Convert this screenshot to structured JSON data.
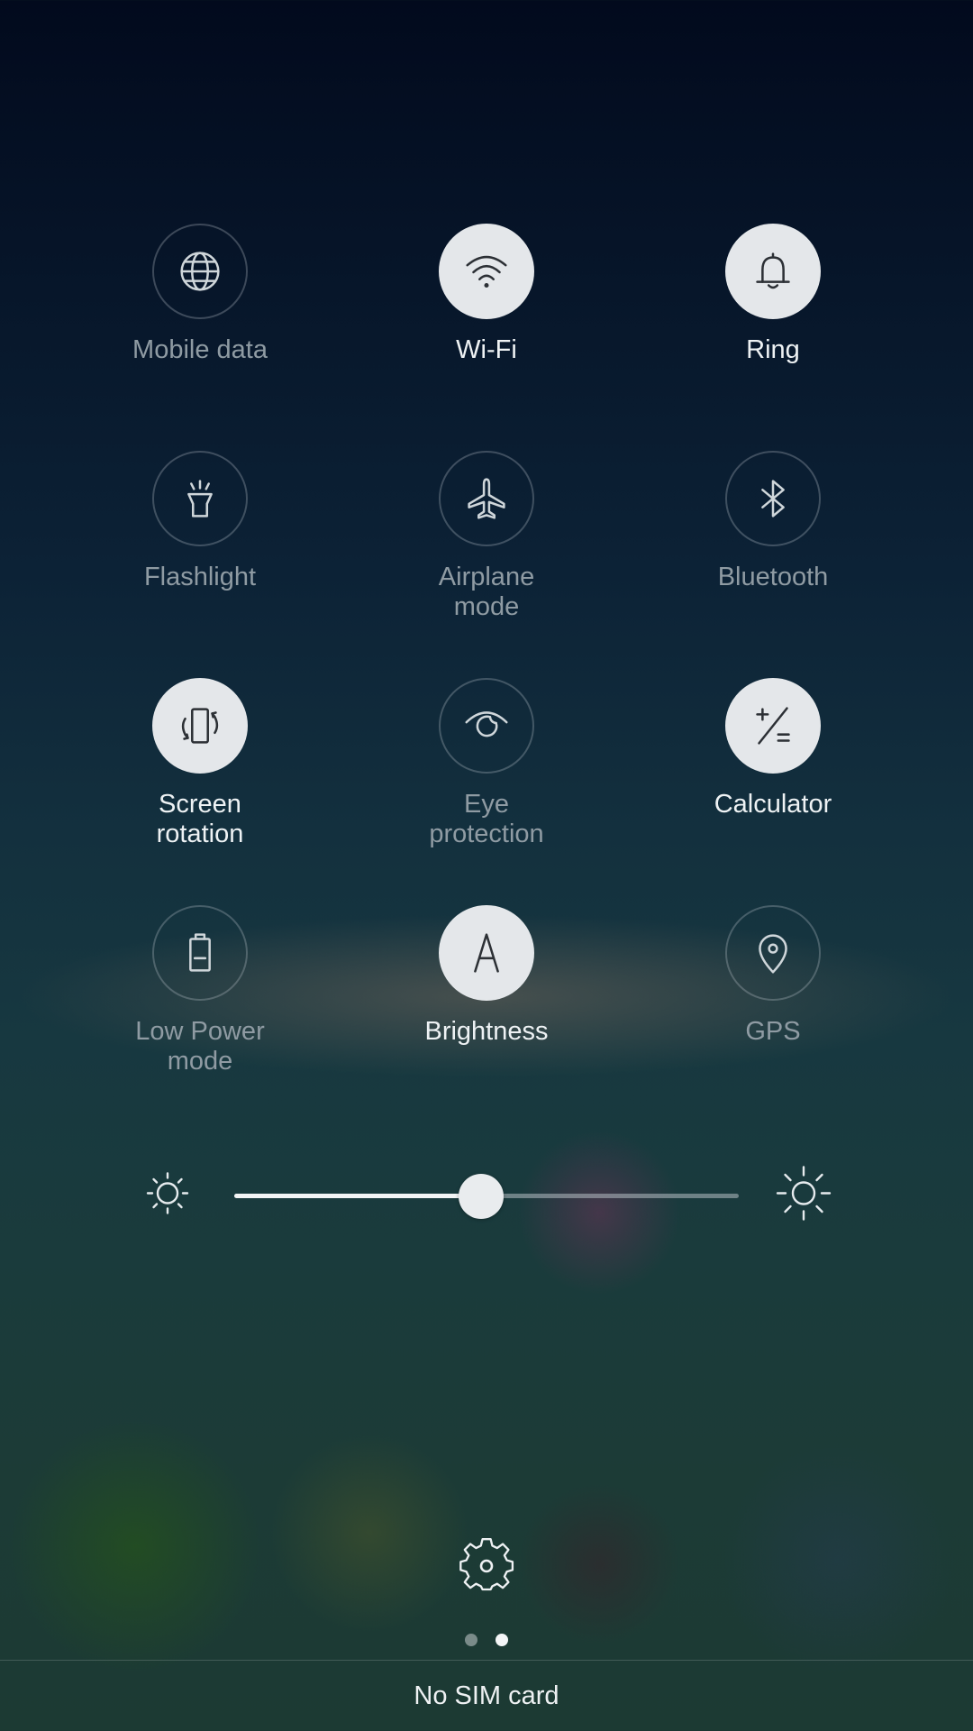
{
  "tiles": [
    {
      "id": "mobile-data",
      "label": "Mobile data",
      "icon": "globe-icon",
      "state": "off"
    },
    {
      "id": "wifi",
      "label": "Wi-Fi",
      "icon": "wifi-icon",
      "state": "on"
    },
    {
      "id": "ring",
      "label": "Ring",
      "icon": "bell-icon",
      "state": "on"
    },
    {
      "id": "flashlight",
      "label": "Flashlight",
      "icon": "flashlight-icon",
      "state": "off"
    },
    {
      "id": "airplane-mode",
      "label": "Airplane\nmode",
      "icon": "airplane-icon",
      "state": "off"
    },
    {
      "id": "bluetooth",
      "label": "Bluetooth",
      "icon": "bluetooth-icon",
      "state": "off"
    },
    {
      "id": "screen-rotation",
      "label": "Screen\nrotation",
      "icon": "screen-rotation-icon",
      "state": "on"
    },
    {
      "id": "eye-protection",
      "label": "Eye\nprotection",
      "icon": "eye-icon",
      "state": "off"
    },
    {
      "id": "calculator",
      "label": "Calculator",
      "icon": "calculator-icon",
      "state": "on"
    },
    {
      "id": "low-power-mode",
      "label": "Low Power\nmode",
      "icon": "battery-icon",
      "state": "off"
    },
    {
      "id": "brightness",
      "label": "Brightness",
      "icon": "auto-brightness-icon",
      "state": "on"
    },
    {
      "id": "gps",
      "label": "GPS",
      "icon": "location-pin-icon",
      "state": "off"
    }
  ],
  "brightness_slider": {
    "level": 0.49,
    "min_icon": "sun-small-icon",
    "max_icon": "sun-large-icon"
  },
  "settings_icon": "gear-icon",
  "pager": {
    "pages": 2,
    "active_index": 1
  },
  "footer": {
    "status_text": "No SIM card"
  },
  "colors": {
    "tile_on_bg": "#e4e7ea",
    "label_off": "#8f9ba3",
    "label_on": "#eef2f4"
  }
}
